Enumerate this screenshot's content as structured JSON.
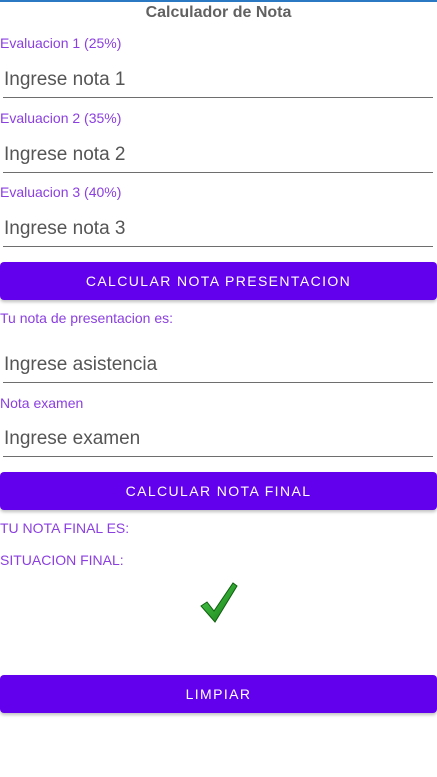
{
  "app": {
    "title": "Calculador de Nota"
  },
  "form": {
    "eval1": {
      "label": "Evaluacion 1 (25%)",
      "placeholder": "Ingrese nota 1",
      "value": ""
    },
    "eval2": {
      "label": "Evaluacion 2 (35%)",
      "placeholder": "Ingrese nota 2",
      "value": ""
    },
    "eval3": {
      "label": "Evaluacion 3 (40%)",
      "placeholder": "Ingrese nota 3",
      "value": ""
    },
    "calc_presentation_button": "CALCULAR NOTA PRESENTACION",
    "presentation_result_label": "Tu nota de presentacion es:",
    "attendance": {
      "placeholder": "Ingrese asistencia",
      "value": ""
    },
    "exam": {
      "label": "Nota examen",
      "placeholder": "Ingrese examen",
      "value": ""
    },
    "calc_final_button": "CALCULAR NOTA FINAL",
    "final_grade_label": "TU NOTA FINAL ES:",
    "final_status_label": "SITUACION FINAL:",
    "status_icon": "checkmark-icon",
    "clear_button": "LIMPIAR"
  },
  "colors": {
    "accent": "#6200ee",
    "label": "#8b3fe0",
    "title": "#616161",
    "check_green": "#1a9a1a"
  }
}
